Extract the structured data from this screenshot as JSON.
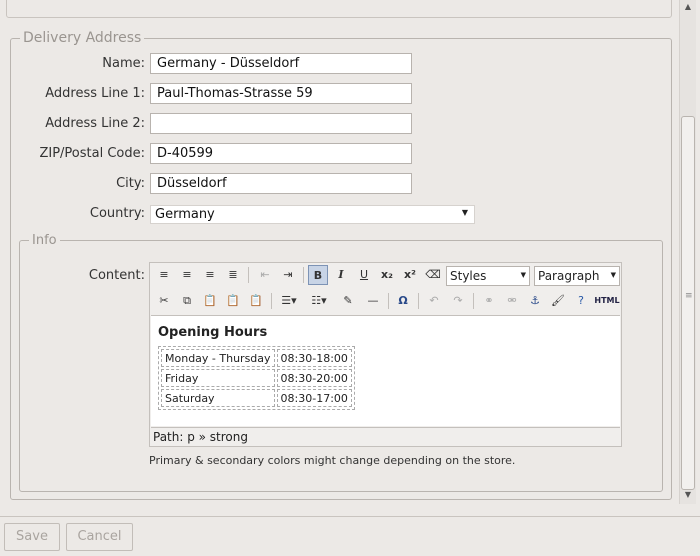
{
  "delivery": {
    "legend": "Delivery Address",
    "fields": [
      {
        "label": "Name:",
        "value": "Germany - Düsseldorf"
      },
      {
        "label": "Address Line 1:",
        "value": "Paul-Thomas-Strasse 59"
      },
      {
        "label": "Address Line 2:",
        "value": ""
      },
      {
        "label": "ZIP/Postal Code:",
        "value": "D-40599"
      },
      {
        "label": "City:",
        "value": "Düsseldorf"
      }
    ],
    "country": {
      "label": "Country:",
      "value": "Germany"
    }
  },
  "info": {
    "legend": "Info",
    "content_label": "Content:",
    "toolbar": {
      "styles_value": "Styles",
      "format_value": "Paragraph",
      "html_label": "HTML",
      "row1_icons": [
        "align-left-icon",
        "align-center-icon",
        "align-right-icon",
        "align-justify-icon",
        "outdent-icon",
        "indent-icon",
        "bold-icon",
        "italic-icon",
        "underline-icon",
        "subscript-icon",
        "superscript-icon",
        "eraser-icon"
      ],
      "row2_icons": [
        "cut-icon",
        "copy-icon",
        "paste-icon",
        "paste-text-icon",
        "paste-word-icon",
        "bullet-list-icon",
        "numbered-list-icon",
        "edit-icon",
        "horizontal-rule-icon",
        "special-char-icon",
        "undo-icon",
        "redo-icon",
        "link-icon",
        "unlink-icon",
        "anchor-icon",
        "cleanup-icon",
        "help-icon",
        "html-icon"
      ]
    },
    "editor": {
      "heading": "Opening Hours",
      "hours": [
        {
          "day": "Monday - Thursday",
          "time": "08:30-18:00"
        },
        {
          "day": "Friday",
          "time": "08:30-20:00"
        },
        {
          "day": "Saturday",
          "time": "08:30-17:00"
        }
      ],
      "path": "Path: p » strong"
    },
    "note": "Primary & secondary colors might change depending on the store."
  },
  "footer": {
    "save_label": "Save",
    "cancel_label": "Cancel"
  }
}
